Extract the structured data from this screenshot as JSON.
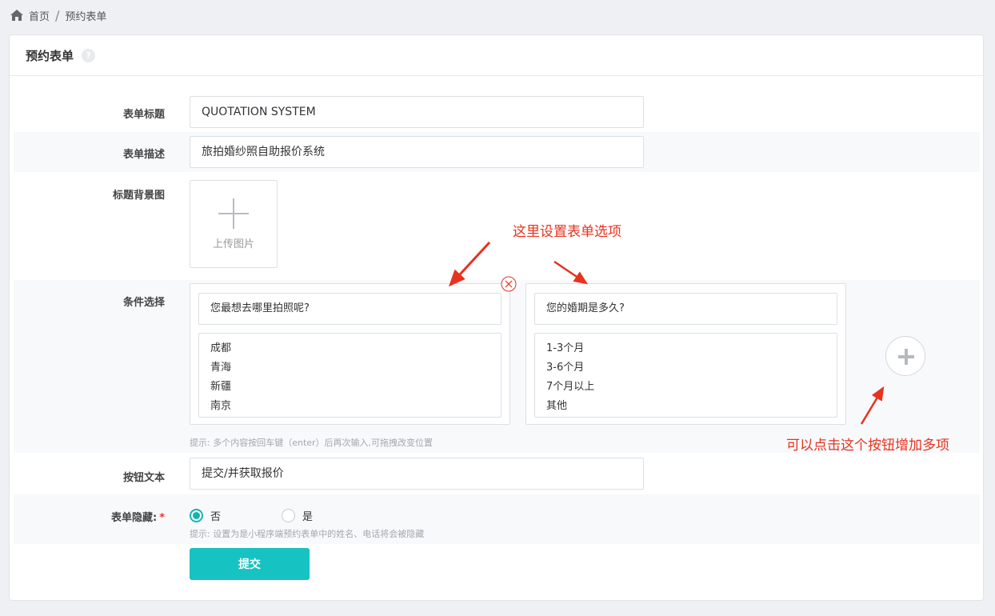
{
  "breadcrumb": {
    "home": "首页",
    "current": "预约表单",
    "separator": "/"
  },
  "panel": {
    "title": "预约表单",
    "help": "?"
  },
  "form": {
    "title_label": "表单标题",
    "title_value": "QUOTATION SYSTEM",
    "desc_label": "表单描述",
    "desc_value": "旅拍婚纱照自助报价系统",
    "bg_label": "标题背景图",
    "upload_text": "上传图片",
    "cond_label": "条件选择",
    "options": [
      {
        "question": "您最想去哪里拍照呢?",
        "items": [
          "成都",
          "青海",
          "新疆",
          "南京"
        ]
      },
      {
        "question": "您的婚期是多久?",
        "items": [
          "1-3个月",
          "3-6个月",
          "7个月以上",
          "其他"
        ]
      }
    ],
    "cond_hint": "提示: 多个内容按回车键（enter）后再次输入,可拖拽改变位置",
    "button_label": "按钮文本",
    "button_value": "提交/并获取报价",
    "hide_label": "表单隐藏:",
    "hide_required": "*",
    "hide_options": [
      "否",
      "是"
    ],
    "hide_selected": "否",
    "hide_hint": "提示: 设置为是小程序端预约表单中的姓名、电话将会被隐藏",
    "submit": "提交"
  },
  "annotations": {
    "options_note": "这里设置表单选项",
    "add_note": "可以点击这个按钮增加多项"
  },
  "colors": {
    "accent": "#17c2c2",
    "annotation": "#e8321e",
    "radio": "#17b3b4"
  }
}
